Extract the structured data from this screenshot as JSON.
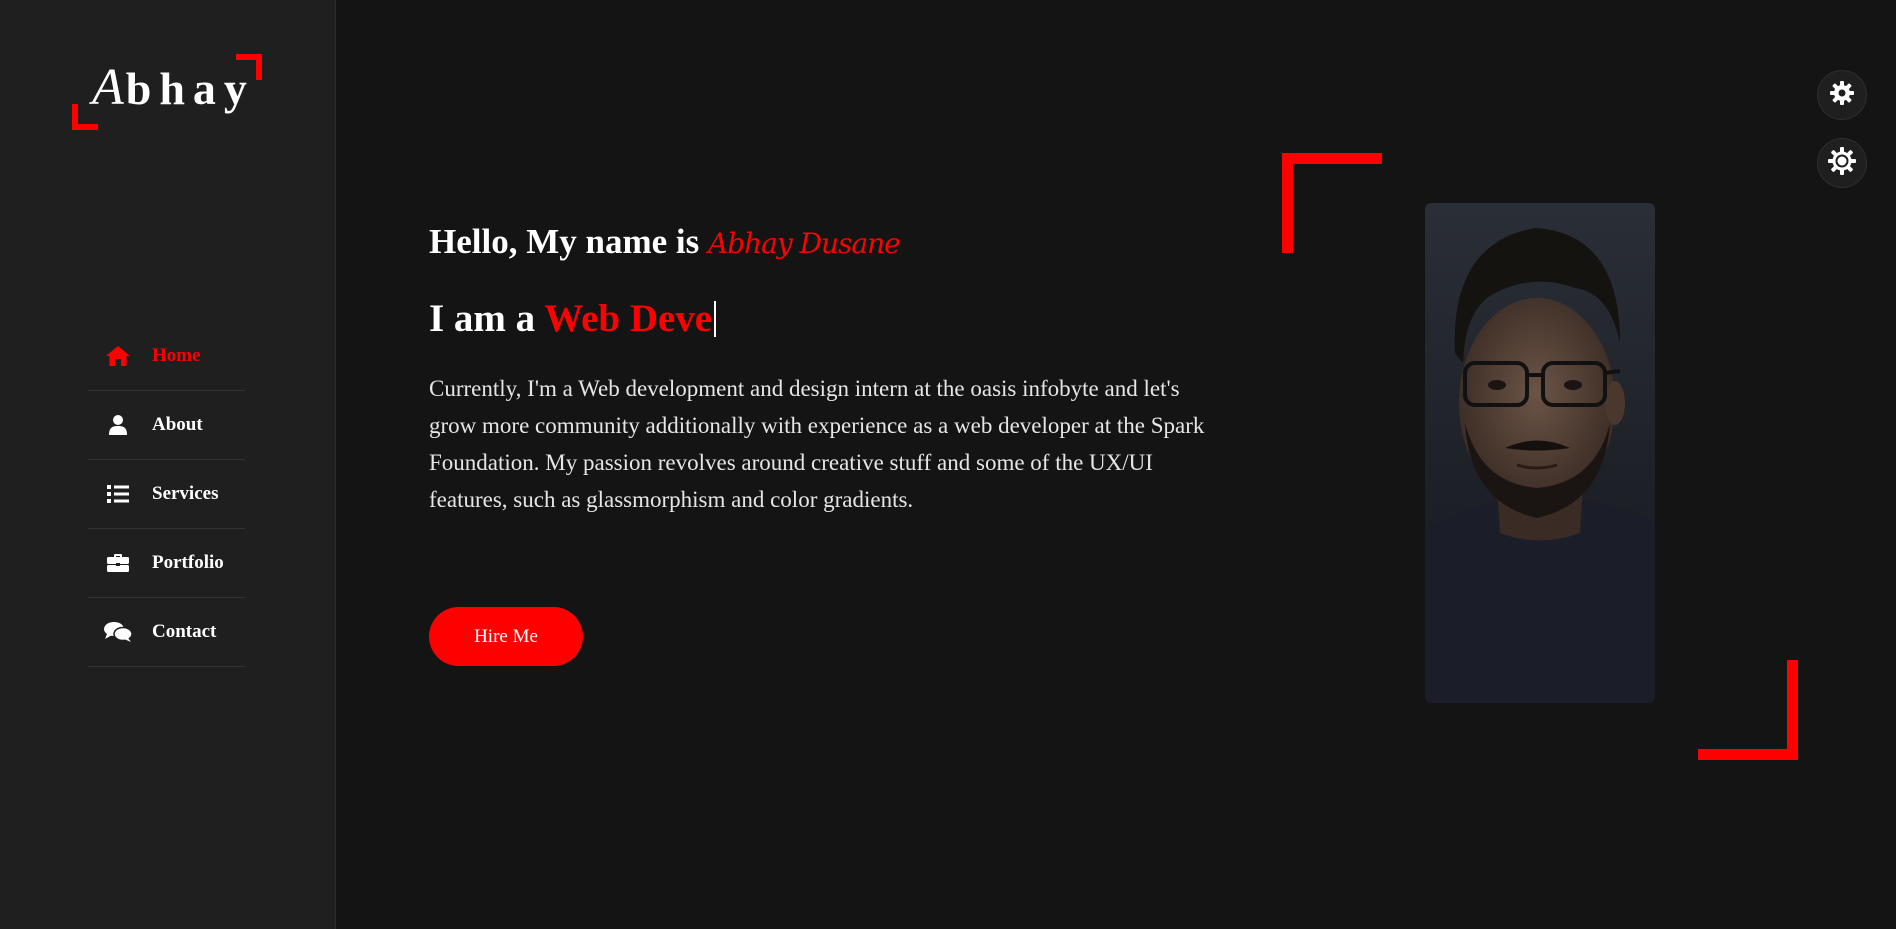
{
  "logo": {
    "first_letter": "A",
    "rest": "bhay"
  },
  "nav": {
    "items": [
      {
        "label": "Home",
        "icon": "home-icon",
        "active": true
      },
      {
        "label": "About",
        "icon": "user-icon",
        "active": false
      },
      {
        "label": "Services",
        "icon": "list-icon",
        "active": false
      },
      {
        "label": "Portfolio",
        "icon": "briefcase-icon",
        "active": false
      },
      {
        "label": "Contact",
        "icon": "comments-icon",
        "active": false
      }
    ]
  },
  "hero": {
    "greeting_prefix": "Hello, My name is ",
    "name": "Abhay Dusane",
    "role_prefix": "I am a ",
    "role_typed": "Web Deve",
    "bio": "Currently, I'm a Web development and design intern at the oasis infobyte and let's grow more community additionally with experience as a web developer at the Spark Foundation. My passion revolves around creative stuff and some of the UX/UI features, such as glassmorphism and color gradients.",
    "cta_label": "Hire Me"
  },
  "floating": {
    "settings_icon": "gear-icon",
    "theme_icon": "sun-icon"
  },
  "colors": {
    "accent": "#ff0000",
    "background": "#141414",
    "sidebar": "#1f1f1f",
    "text": "#ffffff"
  }
}
